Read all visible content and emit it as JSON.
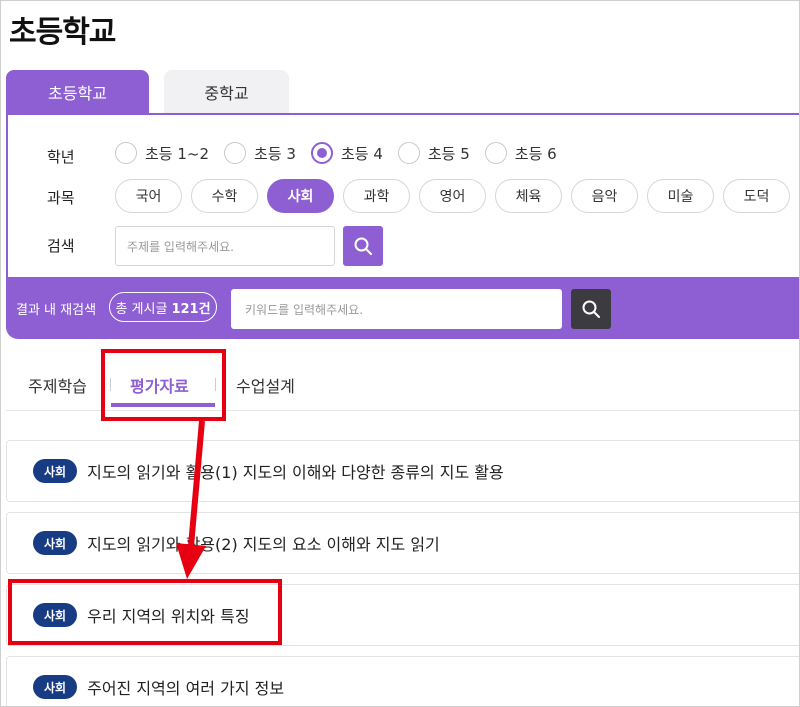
{
  "page": {
    "title": "초등학교"
  },
  "school_tabs": [
    {
      "label": "초등학교",
      "active": true
    },
    {
      "label": "중학교",
      "active": false
    }
  ],
  "filters": {
    "grade_label": "학년",
    "grades": [
      {
        "label": "초등 1~2",
        "checked": false
      },
      {
        "label": "초등 3",
        "checked": false
      },
      {
        "label": "초등 4",
        "checked": true
      },
      {
        "label": "초등 5",
        "checked": false
      },
      {
        "label": "초등 6",
        "checked": false
      }
    ],
    "subject_label": "과목",
    "subjects": [
      {
        "label": "국어",
        "active": false
      },
      {
        "label": "수학",
        "active": false
      },
      {
        "label": "사회",
        "active": true
      },
      {
        "label": "과학",
        "active": false
      },
      {
        "label": "영어",
        "active": false
      },
      {
        "label": "체육",
        "active": false
      },
      {
        "label": "음악",
        "active": false
      },
      {
        "label": "미술",
        "active": false
      },
      {
        "label": "도덕",
        "active": false
      }
    ],
    "search_label": "검색",
    "search_placeholder": "주제를 입력해주세요."
  },
  "result_bar": {
    "label": "결과 내 재검색",
    "count_prefix": "총 게시글",
    "count_value": "121건",
    "keyword_placeholder": "키워드를 입력해주세요."
  },
  "content_tabs": [
    {
      "label": "주제학습",
      "active": false
    },
    {
      "label": "평가자료",
      "active": true
    },
    {
      "label": "수업설계",
      "active": false
    }
  ],
  "items": [
    {
      "badge": "사회",
      "title": "지도의 읽기와 활용(1) 지도의 이해와 다양한 종류의 지도 활용"
    },
    {
      "badge": "사회",
      "title": "지도의 읽기와 활용(2) 지도의 요소 이해와 지도 읽기"
    },
    {
      "badge": "사회",
      "title": "우리 지역의 위치와 특징"
    },
    {
      "badge": "사회",
      "title": "주어진 지역의 여러 가지 정보"
    }
  ],
  "colors": {
    "accent": "#8d5fd3",
    "badge": "#183c84",
    "highlight": "#e60012",
    "dark_button": "#3c3c40"
  }
}
